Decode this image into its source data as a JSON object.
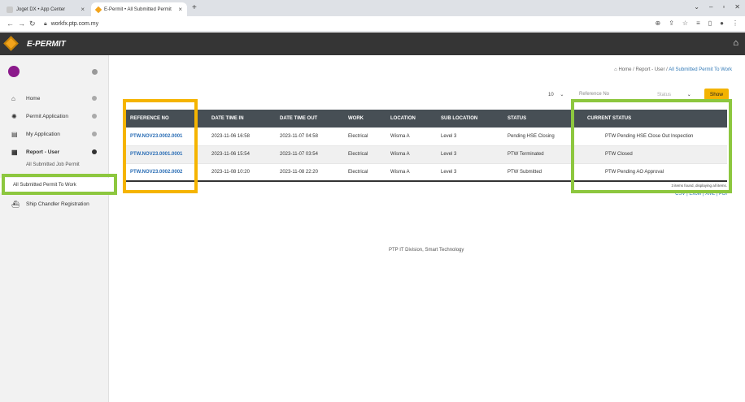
{
  "browser": {
    "tabs": [
      {
        "label": "Joget DX • App Center"
      },
      {
        "label": "E-Permit • All Submitted Permit"
      }
    ],
    "url": "workfx.ptp.com.my"
  },
  "header": {
    "title": "E-PERMIT"
  },
  "sidebar": {
    "items": [
      {
        "label": "Home"
      },
      {
        "label": "Permit Application"
      },
      {
        "label": "My Application"
      },
      {
        "label": "Report - User"
      },
      {
        "label": "All Submitted Job Permit"
      },
      {
        "label": "All Submitted Permit To Work"
      },
      {
        "label": "Ship Chandler Registration"
      }
    ]
  },
  "breadcrumb": {
    "home": "Home",
    "sep1": "/",
    "section": "Report - User",
    "sep2": "/",
    "current": "All Submitted Permit To Work"
  },
  "filters": {
    "page_size": "10",
    "reference_placeholder": "Reference No",
    "status_placeholder": "Status",
    "show_label": "Show"
  },
  "table": {
    "columns": [
      "REFERENCE NO",
      "DATE TIME IN",
      "DATE TIME OUT",
      "WORK",
      "LOCATION",
      "SUB LOCATION",
      "STATUS",
      "CURRENT STATUS"
    ],
    "rows": [
      [
        "PTW.NOV23.0002.0001",
        "2023-11-06 16:58",
        "2023-11-07 04:58",
        "Electrical",
        "Wisma A",
        "Level 3",
        "Pending HSE Closing",
        "PTW Pending HSE Close Out Inspection"
      ],
      [
        "PTW.NOV23.0001.0001",
        "2023-11-06 15:54",
        "2023-11-07 03:54",
        "Electrical",
        "Wisma A",
        "Level 3",
        "PTW Terminated",
        "PTW Closed"
      ],
      [
        "PTW.NOV23.0002.0002",
        "2023-11-08 10:20",
        "2023-11-08 22:20",
        "Electrical",
        "Wisma A",
        "Level 3",
        "PTW Submitted",
        "PTW Pending AO Approval"
      ]
    ],
    "found_text": "3 items found, displaying all items.",
    "exports": [
      "CSV",
      "Excel",
      "XML",
      "PDF"
    ]
  },
  "footer": {
    "text": "PTP IT Division, Smart Technology"
  },
  "colors": {
    "accent": "#f3b300",
    "header_bg": "#353535",
    "table_head": "#474f55",
    "link": "#2a6db5",
    "highlight_orange": "#f5b400",
    "highlight_green": "#8dc73f"
  }
}
